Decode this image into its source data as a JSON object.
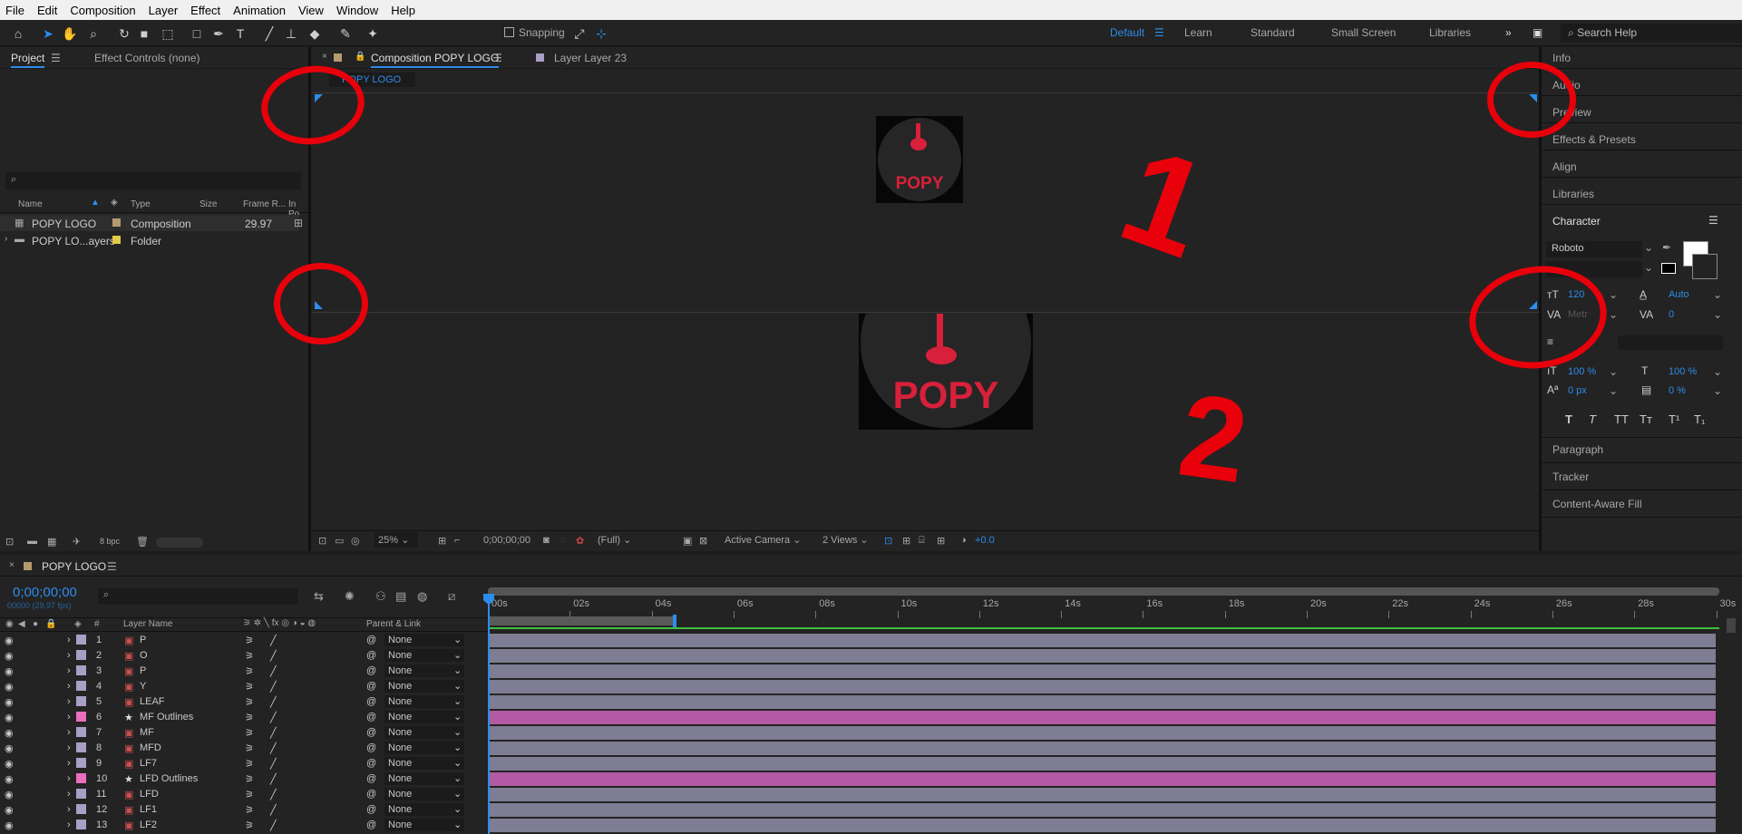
{
  "menu": [
    "File",
    "Edit",
    "Composition",
    "Layer",
    "Effect",
    "Animation",
    "View",
    "Window",
    "Help"
  ],
  "toolbar": {
    "snapping": "Snapping",
    "workspaces": [
      "Default",
      "Learn",
      "Standard",
      "Small Screen",
      "Libraries"
    ],
    "search": "Search Help"
  },
  "project": {
    "tab": "Project",
    "effects_tab": "Effect Controls (none)",
    "columns": [
      "Name",
      "Type",
      "Size",
      "Frame R...",
      "In Po"
    ],
    "items": [
      {
        "name": "POPY LOGO",
        "type": "Composition",
        "fps": "29.97"
      },
      {
        "name": "POPY LO...ayers",
        "type": "Folder",
        "fps": ""
      }
    ],
    "bpc": "8 bpc"
  },
  "viewer": {
    "tab1": "Composition POPY LOGO",
    "tab2": "Layer  Layer 23",
    "breadcrumb": "POPY LOGO",
    "logo_text": "POPY",
    "zoom": "25%",
    "timecode": "0;00;00;00",
    "resolution": "(Full)",
    "camera": "Active Camera",
    "views": "2 Views",
    "exposure": "+0.0",
    "annot1": "1",
    "annot2": "2"
  },
  "right_panel": {
    "items": [
      "Info",
      "Audio",
      "Preview",
      "Effects & Presets",
      "Align",
      "Libraries"
    ],
    "character": "Character",
    "font": "Roboto",
    "size": "120",
    "leading": "Auto",
    "kerning": "Metr",
    "tracking": "0",
    "vscale": "100 %",
    "hscale": "100 %",
    "baseline": "0 px",
    "tsume": "0 %",
    "paragraph": "Paragraph",
    "tracker": "Tracker",
    "caf": "Content-Aware Fill"
  },
  "timeline": {
    "comp": "POPY LOGO",
    "timecode": "0;00;00;00",
    "fps": "00000 (29.97 fps)",
    "col_layer": "Layer Name",
    "col_parent": "Parent & Link",
    "ruler": [
      "00s",
      "02s",
      "04s",
      "06s",
      "08s",
      "10s",
      "12s",
      "14s",
      "16s",
      "18s",
      "20s",
      "22s",
      "24s",
      "26s",
      "28s",
      "30s"
    ],
    "layers": [
      {
        "num": "1",
        "name": "P",
        "parent": "None",
        "color": "#a99ec4",
        "shape": false
      },
      {
        "num": "2",
        "name": "O",
        "parent": "None",
        "color": "#a99ec4",
        "shape": false
      },
      {
        "num": "3",
        "name": "P",
        "parent": "None",
        "color": "#a99ec4",
        "shape": false
      },
      {
        "num": "4",
        "name": "Y",
        "parent": "None",
        "color": "#a99ec4",
        "shape": false
      },
      {
        "num": "5",
        "name": "LEAF",
        "parent": "None",
        "color": "#a99ec4",
        "shape": false
      },
      {
        "num": "6",
        "name": "MF Outlines",
        "parent": "None",
        "color": "#e96fbe",
        "shape": true
      },
      {
        "num": "7",
        "name": "MF",
        "parent": "None",
        "color": "#a99ec4",
        "shape": false
      },
      {
        "num": "8",
        "name": "MFD",
        "parent": "None",
        "color": "#a99ec4",
        "shape": false
      },
      {
        "num": "9",
        "name": "LF7",
        "parent": "None",
        "color": "#a99ec4",
        "shape": false
      },
      {
        "num": "10",
        "name": "LFD Outlines",
        "parent": "None",
        "color": "#e96fbe",
        "shape": true
      },
      {
        "num": "11",
        "name": "LFD",
        "parent": "None",
        "color": "#a99ec4",
        "shape": false
      },
      {
        "num": "12",
        "name": "LF1",
        "parent": "None",
        "color": "#a99ec4",
        "shape": false
      },
      {
        "num": "13",
        "name": "LF2",
        "parent": "None",
        "color": "#a99ec4",
        "shape": false
      }
    ]
  },
  "colors": {
    "accent": "#2d8ceb",
    "annotation": "#e8000b",
    "logo_red": "#d8203a"
  }
}
